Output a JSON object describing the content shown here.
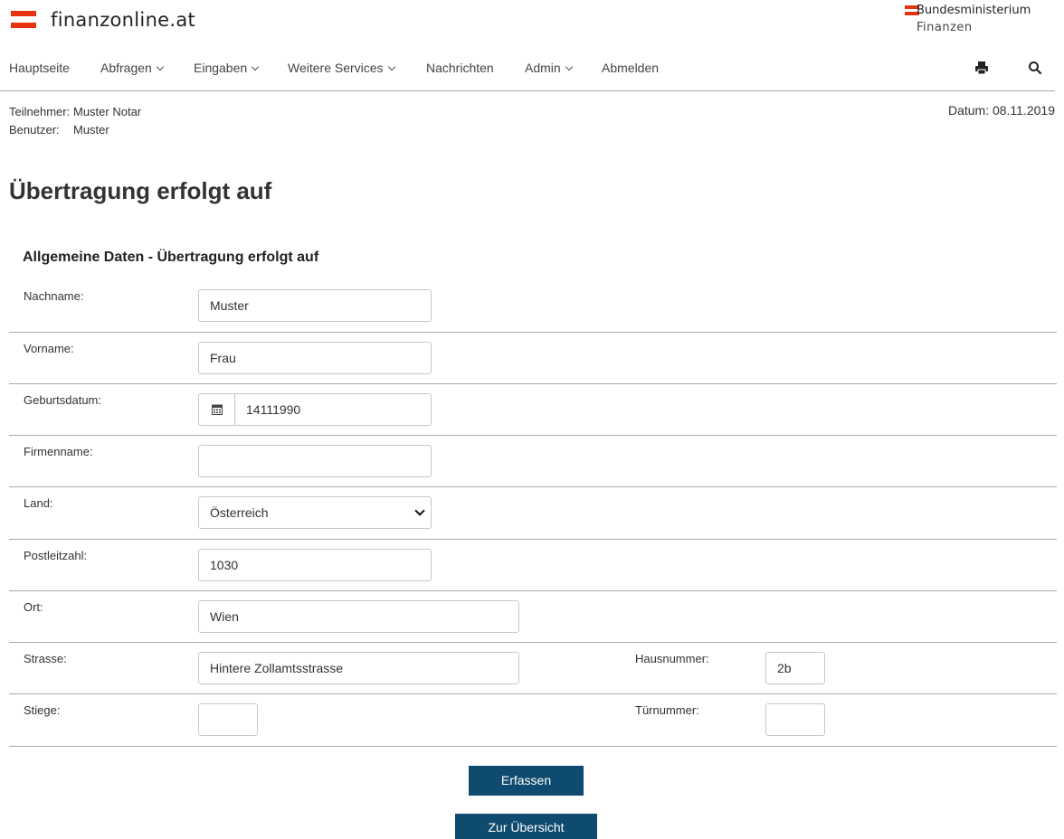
{
  "header": {
    "logo_text": "finanzonline.at",
    "ministry_line1": "Bundesministerium",
    "ministry_line2": "Finanzen",
    "brand_color": "#e6320f"
  },
  "nav": {
    "items": [
      {
        "label": "Hauptseite",
        "dropdown": false
      },
      {
        "label": "Abfragen",
        "dropdown": true
      },
      {
        "label": "Eingaben",
        "dropdown": true
      },
      {
        "label": "Weitere Services",
        "dropdown": true
      },
      {
        "label": "Nachrichten",
        "dropdown": false
      },
      {
        "label": "Admin",
        "dropdown": true
      },
      {
        "label": "Abmelden",
        "dropdown": false
      }
    ],
    "icons": [
      "print-icon",
      "search-icon"
    ]
  },
  "user_info": {
    "teilnehmer_label": "Teilnehmer:",
    "teilnehmer_value": "Muster Notar",
    "benutzer_label": "Benutzer:",
    "benutzer_value": "Muster",
    "datum": "Datum: 08.11.2019"
  },
  "page": {
    "title": "Übertragung erfolgt auf",
    "section_title": "Allgemeine Daten - Übertragung erfolgt auf"
  },
  "form": {
    "nachname": {
      "label": "Nachname:",
      "value": "Muster"
    },
    "vorname": {
      "label": "Vorname:",
      "value": "Frau"
    },
    "geburtsdatum": {
      "label": "Geburtsdatum:",
      "value": "14111990"
    },
    "firmenname": {
      "label": "Firmenname:",
      "value": ""
    },
    "land": {
      "label": "Land:",
      "value": "Österreich"
    },
    "postleitzahl": {
      "label": "Postleitzahl:",
      "value": "1030"
    },
    "ort": {
      "label": "Ort:",
      "value": "Wien"
    },
    "strasse": {
      "label": "Strasse:",
      "value": "Hintere Zollamtsstrasse"
    },
    "hausnummer": {
      "label": "Hausnummer:",
      "value": "2b"
    },
    "stiege": {
      "label": "Stiege:",
      "value": ""
    },
    "tuernummer": {
      "label": "Türnummer:",
      "value": ""
    }
  },
  "buttons": {
    "erfassen": "Erfassen",
    "uebersicht": "Zur Übersicht",
    "color": "#0e4b6f"
  }
}
